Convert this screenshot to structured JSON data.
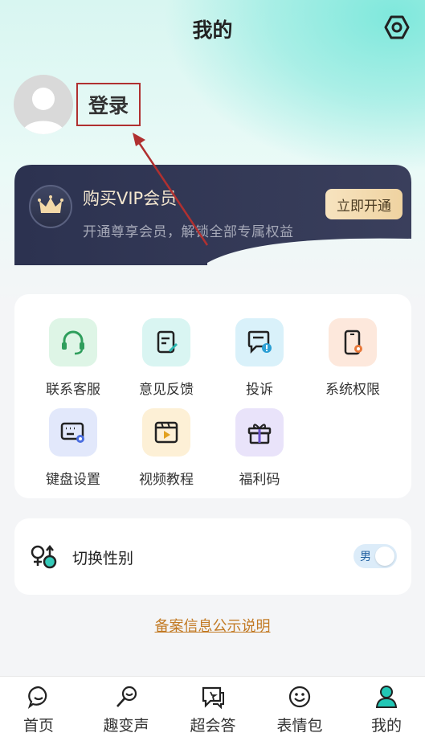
{
  "header": {
    "title": "我的",
    "settings_icon": "gear-icon"
  },
  "profile": {
    "login_label": "登录"
  },
  "vip": {
    "title": "购买VIP会员",
    "subtitle": "开通尊享会员，解锁全部专属权益",
    "button": "立即开通"
  },
  "functions": {
    "items": [
      {
        "label": "联系客服",
        "icon": "headset-icon",
        "color": "#3dbb6b"
      },
      {
        "label": "意见反馈",
        "icon": "feedback-icon",
        "color": "#2bb7b0"
      },
      {
        "label": "投诉",
        "icon": "complaint-icon",
        "color": "#2b9fd4"
      },
      {
        "label": "系统权限",
        "icon": "phone-permission-icon",
        "color": "#e8783a"
      },
      {
        "label": "键盘设置",
        "icon": "keyboard-settings-icon",
        "color": "#4a6de0"
      },
      {
        "label": "视频教程",
        "icon": "video-tutorial-icon",
        "color": "#d89a1c"
      },
      {
        "label": "福利码",
        "icon": "gift-icon",
        "color": "#6b52c9"
      }
    ]
  },
  "gender": {
    "label": "切换性别",
    "toggle_value": "男"
  },
  "footer_link": "备案信息公示说明",
  "tabbar": {
    "tabs": [
      {
        "label": "首页",
        "icon": "home-chat-icon",
        "active": false
      },
      {
        "label": "趣变声",
        "icon": "voice-change-icon",
        "active": false
      },
      {
        "label": "超会答",
        "icon": "answer-chat-icon",
        "active": false
      },
      {
        "label": "表情包",
        "icon": "emoji-icon",
        "active": false
      },
      {
        "label": "我的",
        "icon": "profile-icon",
        "active": true
      }
    ]
  },
  "colors": {
    "accent": "#1fc2b5",
    "vip_bg": "#2a3048",
    "link": "#c27a24",
    "annotation": "#b03030"
  }
}
